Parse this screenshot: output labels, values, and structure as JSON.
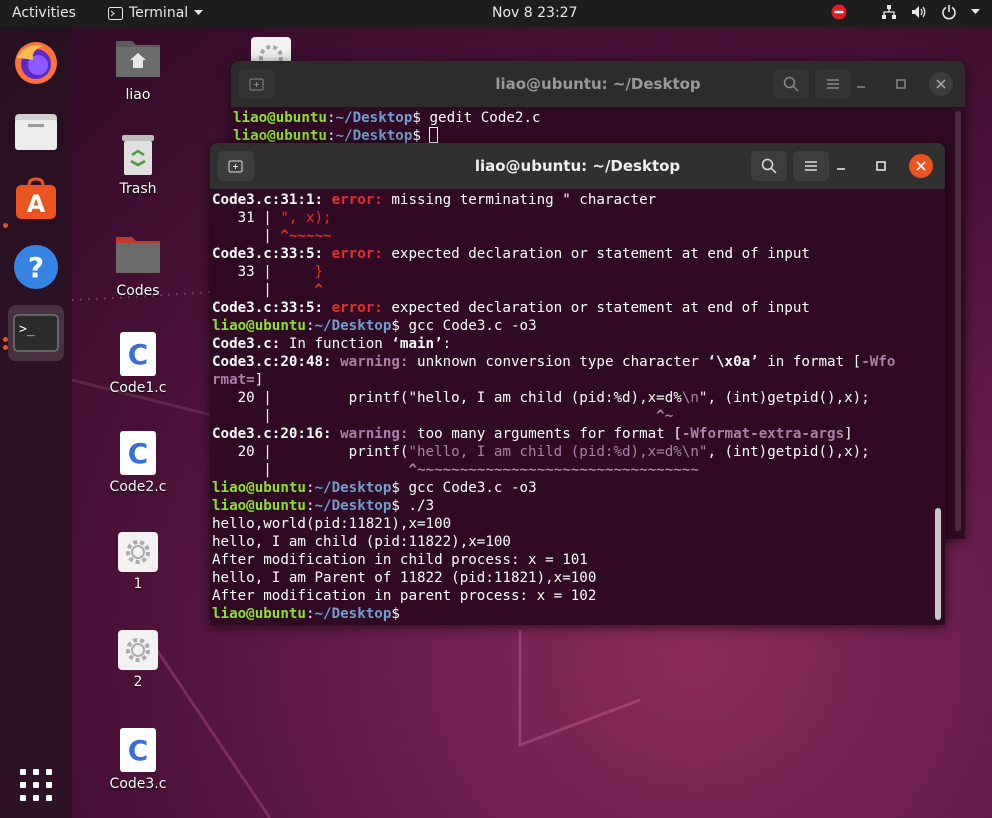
{
  "topbar": {
    "activities": "Activities",
    "app_menu": "Terminal",
    "clock": "Nov 8  23:27"
  },
  "dock": {
    "items": [
      "firefox-icon",
      "files-icon",
      "software-icon",
      "help-icon",
      "terminal-icon",
      "apps-grid-icon"
    ]
  },
  "desktop": {
    "icons": [
      {
        "label": "liao",
        "type": "home-folder"
      },
      {
        "label": "Trash",
        "type": "trash"
      },
      {
        "label": "Codes",
        "type": "folder"
      },
      {
        "label": "Code1.c",
        "type": "c-file"
      },
      {
        "label": "Code2.c",
        "type": "c-file"
      },
      {
        "label": "1",
        "type": "executable"
      },
      {
        "label": "2",
        "type": "executable"
      },
      {
        "label": "Code3.c",
        "type": "c-file"
      }
    ]
  },
  "back_window": {
    "title": "liao@ubuntu: ~/Desktop",
    "prompt_user": "liao@ubuntu",
    "prompt_path": "~/Desktop",
    "line1_cmd": "gedit Code2.c"
  },
  "front_window": {
    "title": "liao@ubuntu: ~/Desktop",
    "lines": {
      "l1_loc": "Code3.c:31:1:",
      "l1_kind": "error:",
      "l1_msg": "missing terminating \" character",
      "l2_num": "   31 | ",
      "l2_code": "\", x);",
      "l3_gutter": "      | ",
      "l3_caret": "^~~~~~",
      "l4_loc": "Code3.c:33:5:",
      "l4_kind": "error:",
      "l4_msg": "expected declaration or statement at end of input",
      "l5_num": "   33 | ",
      "l5_code": "    }",
      "l6_gutter": "      | ",
      "l6_caret": "    ^",
      "l7_loc": "Code3.c:33:5:",
      "l7_kind": "error:",
      "l7_msg": "expected declaration or statement at end of input",
      "l8_user": "liao@ubuntu",
      "l8_path": "~/Desktop",
      "l8_cmd": "gcc Code3.c -o3",
      "l9_loc": "Code3.c:",
      "l9_msg_a": " In function ",
      "l9_fn": "‘main’",
      "l9_msg_b": ":",
      "l10_loc": "Code3.c:20:48:",
      "l10_kind": "warning:",
      "l10_msg_a": "unknown conversion type character ",
      "l10_char": "‘\\x0a’",
      "l10_msg_b": " in format [",
      "l10_flag": "-Wfo",
      "l11_flag": "rmat=",
      "l11_end": "]",
      "l12_num": "   20 | ",
      "l12_code": "        printf(\"hello, I am child (pid:%d),x=d%",
      "l12_hl": "\\n",
      "l12_code_b": "\", (int)getpid(),x);",
      "l13_gutter": "      | ",
      "l13_caret": "                                            ^~",
      "l14_loc": "Code3.c:20:16:",
      "l14_kind": "warning:",
      "l14_msg": "too many arguments for format [",
      "l14_flag": "-Wformat-extra-args",
      "l14_end": "]",
      "l15_num": "   20 | ",
      "l15_code_a": "        printf(",
      "l15_hl": "\"hello, I am child (pid:%d),x=d%\\n\"",
      "l15_code_b": ", (int)getpid(),x);",
      "l16_gutter": "      | ",
      "l16_caret": "               ^~~~~~~~~~~~~~~~~~~~~~~~~~~~~~~~~~",
      "l17_user": "liao@ubuntu",
      "l17_path": "~/Desktop",
      "l17_cmd": "gcc Code3.c -o3",
      "l18_user": "liao@ubuntu",
      "l18_path": "~/Desktop",
      "l18_cmd": "./3",
      "l19": "hello,world(pid:11821),x=100",
      "l20": "hello, I am child (pid:11822),x=100",
      "l21": "After modification in child process: x = 101",
      "l22": "hello, I am Parent of 11822 (pid:11821),x=100",
      "l23": "After modification in parent process: x = 102",
      "l24_user": "liao@ubuntu",
      "l24_path": "~/Desktop"
    }
  }
}
